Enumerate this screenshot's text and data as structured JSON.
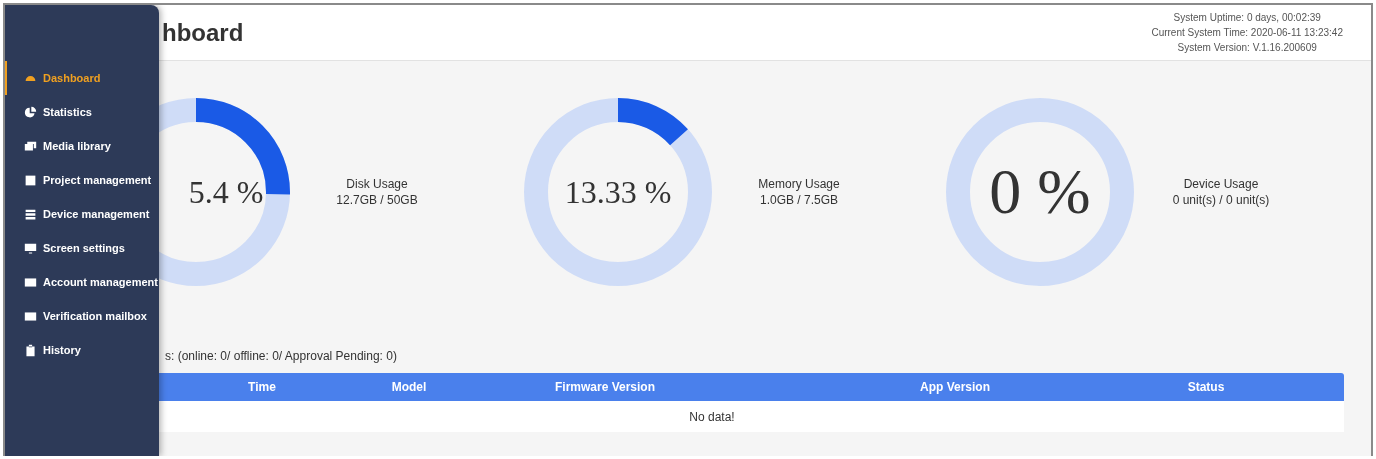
{
  "header": {
    "title": "hboard",
    "info": [
      "System Uptime: 0 days, 00:02:39",
      "Current System Time: 2020-06-11 13:23:42",
      "System Version: V.1.16.200609"
    ]
  },
  "sidebar": {
    "items": [
      {
        "label": "Dashboard",
        "selected": true
      },
      {
        "label": "Statistics",
        "selected": false
      },
      {
        "label": "Media library",
        "selected": false
      },
      {
        "label": "Project management",
        "selected": false
      },
      {
        "label": "Device management",
        "selected": false
      },
      {
        "label": "Screen settings",
        "selected": false
      },
      {
        "label": "Account management",
        "selected": false
      },
      {
        "label": "Verification mailbox",
        "selected": false
      },
      {
        "label": "History",
        "selected": false
      }
    ]
  },
  "gauges": [
    {
      "percent": "5.4 %",
      "level": 0.254,
      "label": "Disk Usage",
      "detail": "12.7GB / 50GB"
    },
    {
      "percent": "13.33 %",
      "level": 0.1333,
      "label": "Memory Usage",
      "detail": "1.0GB / 7.5GB"
    },
    {
      "percent": "0 %",
      "level": 0,
      "label": "Device Usage",
      "detail": "0 unit(s) / 0 unit(s)"
    }
  ],
  "devices": {
    "summary": "s: (online: 0/ offline: 0/ Approval Pending: 0)",
    "columns": [
      "Time",
      "Model",
      "Firmware Version",
      "App Version",
      "Status"
    ],
    "empty": "No data!"
  }
}
